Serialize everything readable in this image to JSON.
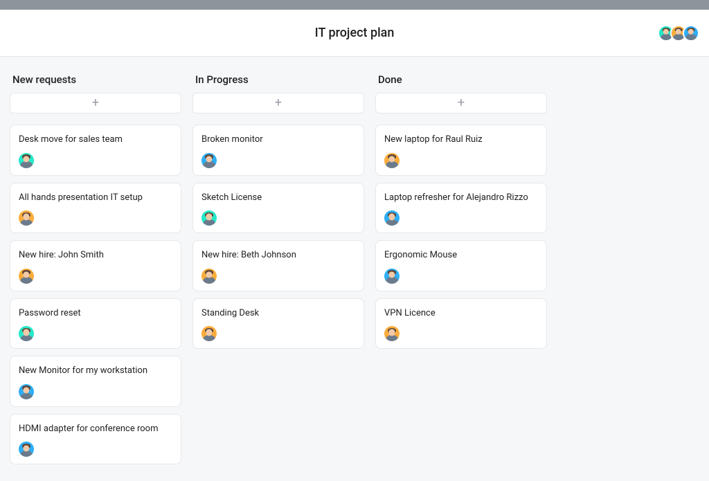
{
  "header": {
    "title": "IT project plan",
    "members": [
      {
        "bg": "bg-green"
      },
      {
        "bg": "bg-orange"
      },
      {
        "bg": "bg-blue"
      }
    ]
  },
  "columns": [
    {
      "id": "new-requests",
      "title": "New requests",
      "cards": [
        {
          "title": "Desk move for sales team",
          "avatar_bg": "bg-green"
        },
        {
          "title": "All hands presentation IT setup",
          "avatar_bg": "bg-orange"
        },
        {
          "title": "New hire: John Smith",
          "avatar_bg": "bg-orange"
        },
        {
          "title": "Password reset",
          "avatar_bg": "bg-green"
        },
        {
          "title": "New Monitor for my workstation",
          "avatar_bg": "bg-blue"
        },
        {
          "title": "HDMI adapter for conference room",
          "avatar_bg": "bg-blue"
        }
      ]
    },
    {
      "id": "in-progress",
      "title": "In Progress",
      "cards": [
        {
          "title": "Broken monitor",
          "avatar_bg": "bg-blue"
        },
        {
          "title": "Sketch License",
          "avatar_bg": "bg-green"
        },
        {
          "title": "New hire: Beth Johnson",
          "avatar_bg": "bg-orange"
        },
        {
          "title": "Standing Desk",
          "avatar_bg": "bg-orange"
        }
      ]
    },
    {
      "id": "done",
      "title": "Done",
      "cards": [
        {
          "title": "New laptop for Raul Ruiz",
          "avatar_bg": "bg-orange"
        },
        {
          "title": "Laptop refresher for Alejandro Rizzo",
          "avatar_bg": "bg-blue"
        },
        {
          "title": "Ergonomic Mouse",
          "avatar_bg": "bg-blue"
        },
        {
          "title": "VPN Licence",
          "avatar_bg": "bg-orange"
        }
      ]
    }
  ]
}
